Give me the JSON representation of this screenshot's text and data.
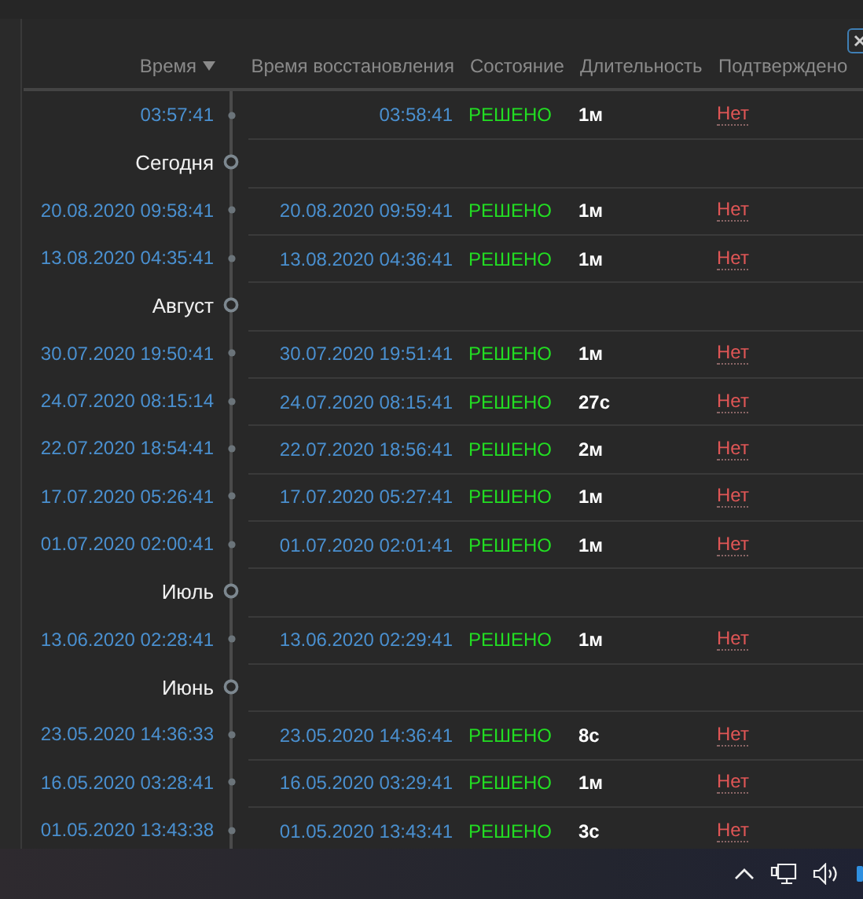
{
  "table": {
    "columns": [
      {
        "label": "Время",
        "sorted": true
      },
      {
        "label": "Время восстановления"
      },
      {
        "label": "Состояние"
      },
      {
        "label": "Длительность"
      },
      {
        "label": "Подтверждено"
      }
    ],
    "rows": [
      {
        "kind": "event",
        "time": "03:57:41",
        "recovery": "03:58:41",
        "status": "РЕШЕНО",
        "duration": "1м",
        "confirmed": "Нет"
      },
      {
        "kind": "group",
        "label": "Сегодня"
      },
      {
        "kind": "event",
        "time": "20.08.2020 09:58:41",
        "recovery": "20.08.2020 09:59:41",
        "status": "РЕШЕНО",
        "duration": "1м",
        "confirmed": "Нет"
      },
      {
        "kind": "event",
        "time": "13.08.2020 04:35:41",
        "recovery": "13.08.2020 04:36:41",
        "status": "РЕШЕНО",
        "duration": "1м",
        "confirmed": "Нет"
      },
      {
        "kind": "group",
        "label": "Август"
      },
      {
        "kind": "event",
        "time": "30.07.2020 19:50:41",
        "recovery": "30.07.2020 19:51:41",
        "status": "РЕШЕНО",
        "duration": "1м",
        "confirmed": "Нет"
      },
      {
        "kind": "event",
        "time": "24.07.2020 08:15:14",
        "recovery": "24.07.2020 08:15:41",
        "status": "РЕШЕНО",
        "duration": "27с",
        "confirmed": "Нет"
      },
      {
        "kind": "event",
        "time": "22.07.2020 18:54:41",
        "recovery": "22.07.2020 18:56:41",
        "status": "РЕШЕНО",
        "duration": "2м",
        "confirmed": "Нет"
      },
      {
        "kind": "event",
        "time": "17.07.2020 05:26:41",
        "recovery": "17.07.2020 05:27:41",
        "status": "РЕШЕНО",
        "duration": "1м",
        "confirmed": "Нет"
      },
      {
        "kind": "event",
        "time": "01.07.2020 02:00:41",
        "recovery": "01.07.2020 02:01:41",
        "status": "РЕШЕНО",
        "duration": "1м",
        "confirmed": "Нет"
      },
      {
        "kind": "group",
        "label": "Июль"
      },
      {
        "kind": "event",
        "time": "13.06.2020 02:28:41",
        "recovery": "13.06.2020 02:29:41",
        "status": "РЕШЕНО",
        "duration": "1м",
        "confirmed": "Нет"
      },
      {
        "kind": "group",
        "label": "Июнь"
      },
      {
        "kind": "event",
        "time": "23.05.2020 14:36:33",
        "recovery": "23.05.2020 14:36:41",
        "status": "РЕШЕНО",
        "duration": "8с",
        "confirmed": "Нет"
      },
      {
        "kind": "event",
        "time": "16.05.2020 03:28:41",
        "recovery": "16.05.2020 03:29:41",
        "status": "РЕШЕНО",
        "duration": "1м",
        "confirmed": "Нет"
      },
      {
        "kind": "event",
        "time": "01.05.2020 13:43:38",
        "recovery": "01.05.2020 13:43:41",
        "status": "РЕШЕНО",
        "duration": "3с",
        "confirmed": "Нет"
      }
    ]
  }
}
